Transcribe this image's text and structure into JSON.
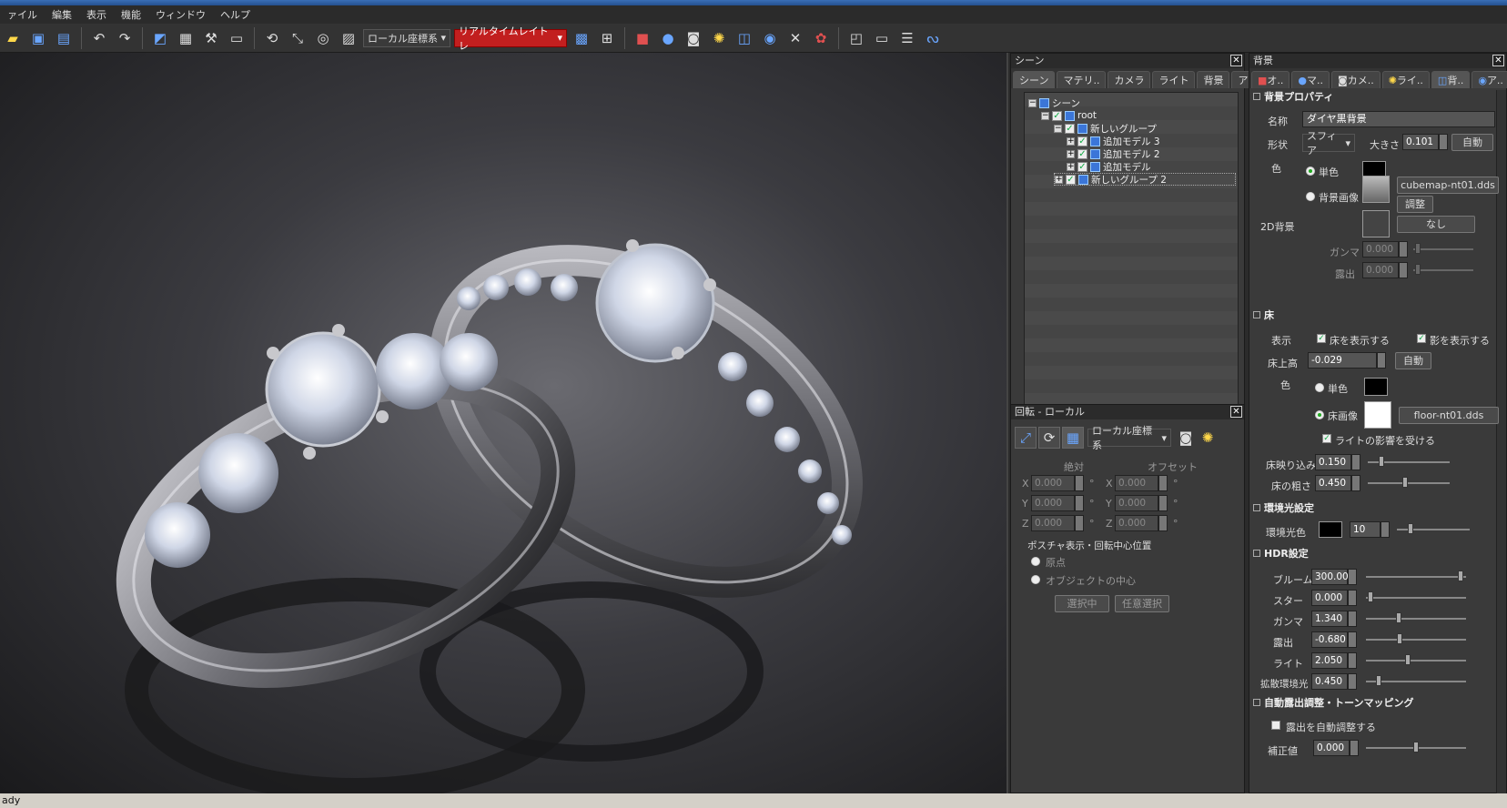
{
  "menu": [
    "ァイル",
    "編集",
    "表示",
    "機能",
    "ウィンドウ",
    "ヘルプ"
  ],
  "toolbar": {
    "coord_system": "ローカル座標系",
    "render_mode": "リアルタイムレイトレ"
  },
  "status": "ady",
  "scene_panel": {
    "title": "シーン",
    "tabs": [
      "シーン",
      "マテリ..",
      "カメラ",
      "ライト",
      "背景",
      "アニメ.."
    ],
    "tree": [
      {
        "label": "シーン",
        "level": 0
      },
      {
        "label": "root",
        "level": 1
      },
      {
        "label": "新しいグループ",
        "level": 2
      },
      {
        "label": "追加モデル 3",
        "level": 3
      },
      {
        "label": "追加モデル 2",
        "level": 3
      },
      {
        "label": "追加モデル",
        "level": 3
      },
      {
        "label": "新しいグループ 2",
        "level": 2
      }
    ]
  },
  "rotate_panel": {
    "title": "回転 - ローカル",
    "coord_system": "ローカル座標系",
    "absolute": "絶対",
    "offset": "オフセット",
    "axes": [
      "X",
      "Y",
      "Z"
    ],
    "abs_values": [
      "0.000",
      "0.000",
      "0.000"
    ],
    "off_values": [
      "0.000",
      "0.000",
      "0.000"
    ],
    "deg": "°",
    "pivot_label": "ポスチャ表示・回転中心位置",
    "pivot_options": [
      "原点",
      "オブジェクトの中心"
    ],
    "buttons": [
      "選択中",
      "任意選択"
    ]
  },
  "bg_panel": {
    "title": "背景",
    "tabs": [
      "オ..",
      "マ..",
      "カメ..",
      "ライ..",
      "背..",
      "ア.."
    ],
    "props": {
      "header": "背景プロパティ",
      "name_label": "名称",
      "name": "ダイヤ黒背景",
      "shape_label": "形状",
      "shape": "スフィア",
      "size_label": "大きさ",
      "size": "0.101",
      "auto": "自動",
      "color_label": "色",
      "solid": "単色",
      "bgimage": "背景画像",
      "cubemap": "cubemap-nt01.dds",
      "adjust": "調整",
      "bg2d_label": "2D背景",
      "none": "なし",
      "gamma_label": "ガンマ",
      "gamma": "0.000",
      "exposure_label": "露出",
      "exposure": "0.000"
    },
    "floor": {
      "header": "床",
      "display_label": "表示",
      "show_floor": "床を表示する",
      "show_shadow": "影を表示する",
      "height_label": "床上高",
      "height": "-0.029",
      "auto": "自動",
      "color_label": "色",
      "solid": "単色",
      "image": "床画像",
      "image_file": "floor-nt01.dds",
      "light_effect": "ライトの影響を受ける",
      "reflect_label": "床映り込み",
      "reflect": "0.150",
      "rough_label": "床の粗さ",
      "rough": "0.450"
    },
    "ambient": {
      "header": "環境光設定",
      "color_label": "環境光色",
      "value": "10"
    },
    "hdr": {
      "header": "HDR設定",
      "rows": [
        {
          "label": "ブルーム",
          "value": "300.00",
          "level": 0.97
        },
        {
          "label": "スター",
          "value": "0.000",
          "level": 0.02
        },
        {
          "label": "ガンマ",
          "value": "1.340",
          "level": 0.32
        },
        {
          "label": "露出",
          "value": "-0.680",
          "level": 0.33
        },
        {
          "label": "ライト",
          "value": "2.050",
          "level": 0.41
        },
        {
          "label": "拡散環境光",
          "value": "0.450",
          "level": 0.11
        }
      ]
    },
    "tonemap": {
      "header": "自動露出調整・トーンマッピング",
      "auto_exposure": "露出を自動調整する",
      "correction_label": "補正値",
      "correction": "0.000"
    }
  },
  "colors": {
    "accent_red": "#c21f1f",
    "panel": "#3a3a3a",
    "folder_blue": "#3b76d8"
  }
}
